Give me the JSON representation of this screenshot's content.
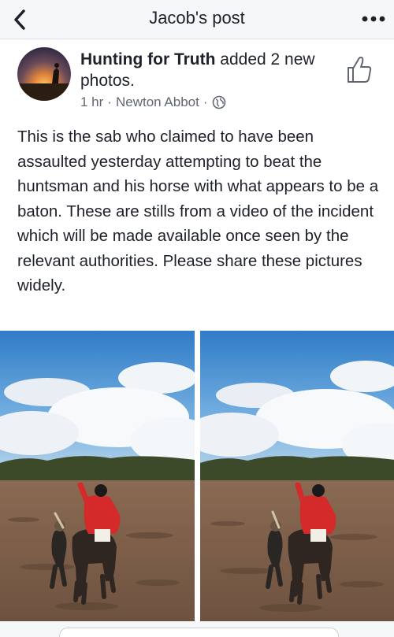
{
  "header": {
    "title": "Jacob's post",
    "back_icon": "chevron-left-icon",
    "more_icon": "more-horizontal-icon"
  },
  "post": {
    "author": "Hunting for Truth",
    "action": " added 2 new photos.",
    "time": "1 hr",
    "location": "Newton Abbot",
    "privacy_icon": "globe-icon",
    "like_icon": "thumbs-up-outline-icon",
    "text": "This is the sab who claimed to have been assaulted yesterday attempting to beat the huntsman and his horse with what appears to be a baton. These are stills from a video of the incident which will be made available once seen by the relevant authorities. Please share these pictures widely."
  },
  "photos": [
    {
      "subject": "rider-in-red-coat-on-horse-with-protester"
    },
    {
      "subject": "rider-in-red-coat-on-horse-with-protester"
    }
  ],
  "colors": {
    "text": "#1d2129",
    "meta": "#616770",
    "bar": "#f6f7f9",
    "sky": "#3f8ad0",
    "field": "#7a5a44",
    "coat": "#d42a2a"
  }
}
